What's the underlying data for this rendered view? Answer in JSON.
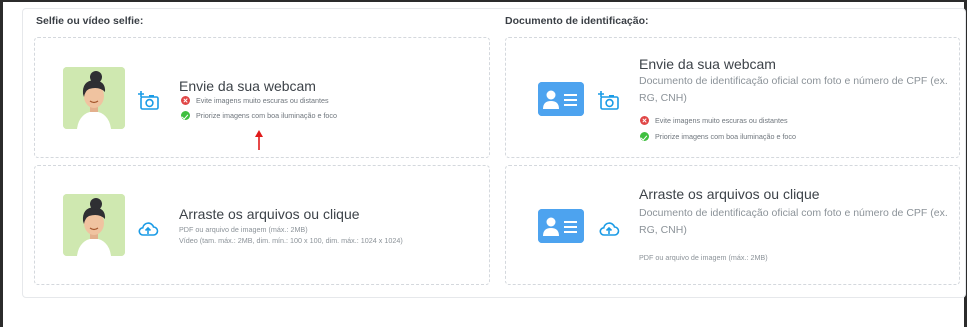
{
  "selfie_section": {
    "label": "Selfie ou vídeo selfie:",
    "webcam": {
      "title": "Envie da sua webcam",
      "tips": [
        {
          "status": "error",
          "text": "Evite imagens muito escuras ou distantes"
        },
        {
          "status": "ok",
          "text": "Priorize imagens com boa iluminação e foco"
        }
      ]
    },
    "upload": {
      "title": "Arraste os arquivos ou clique",
      "hint_line1": "PDF ou arquivo de imagem (máx.: 2MB)",
      "hint_line2": "Vídeo (tam. máx.: 2MB, dim. mín.: 100 x 100, dim. máx.: 1024 x 1024)"
    }
  },
  "document_section": {
    "label": "Documento de identificação:",
    "webcam": {
      "title": "Envie da sua webcam",
      "description": "Documento de identificação oficial com foto e número de CPF (ex. RG, CNH)",
      "tips": [
        {
          "status": "error",
          "text": "Evite imagens muito escuras ou distantes"
        },
        {
          "status": "ok",
          "text": "Priorize imagens com boa iluminação e foco"
        }
      ]
    },
    "upload": {
      "title": "Arraste os arquivos ou clique",
      "description": "Documento de identificação oficial com foto e número de CPF (ex. RG, CNH)",
      "hint": "PDF ou arquivo de imagem (máx.: 2MB)"
    }
  },
  "icons": {
    "avatar": "selfie-avatar-icon",
    "id_card": "id-card-icon",
    "camera": "add-camera-icon",
    "upload": "cloud-upload-icon",
    "error": "x-circle-icon",
    "ok": "check-circle-icon",
    "annotation": "red-arrow-icon"
  },
  "colors": {
    "accent": "#1a9be6",
    "id_card": "#4da3ef",
    "avatar_bg": "#cfe8b0",
    "error": "#e04646",
    "ok": "#3fbf3f",
    "annotation": "#e01b1b"
  }
}
